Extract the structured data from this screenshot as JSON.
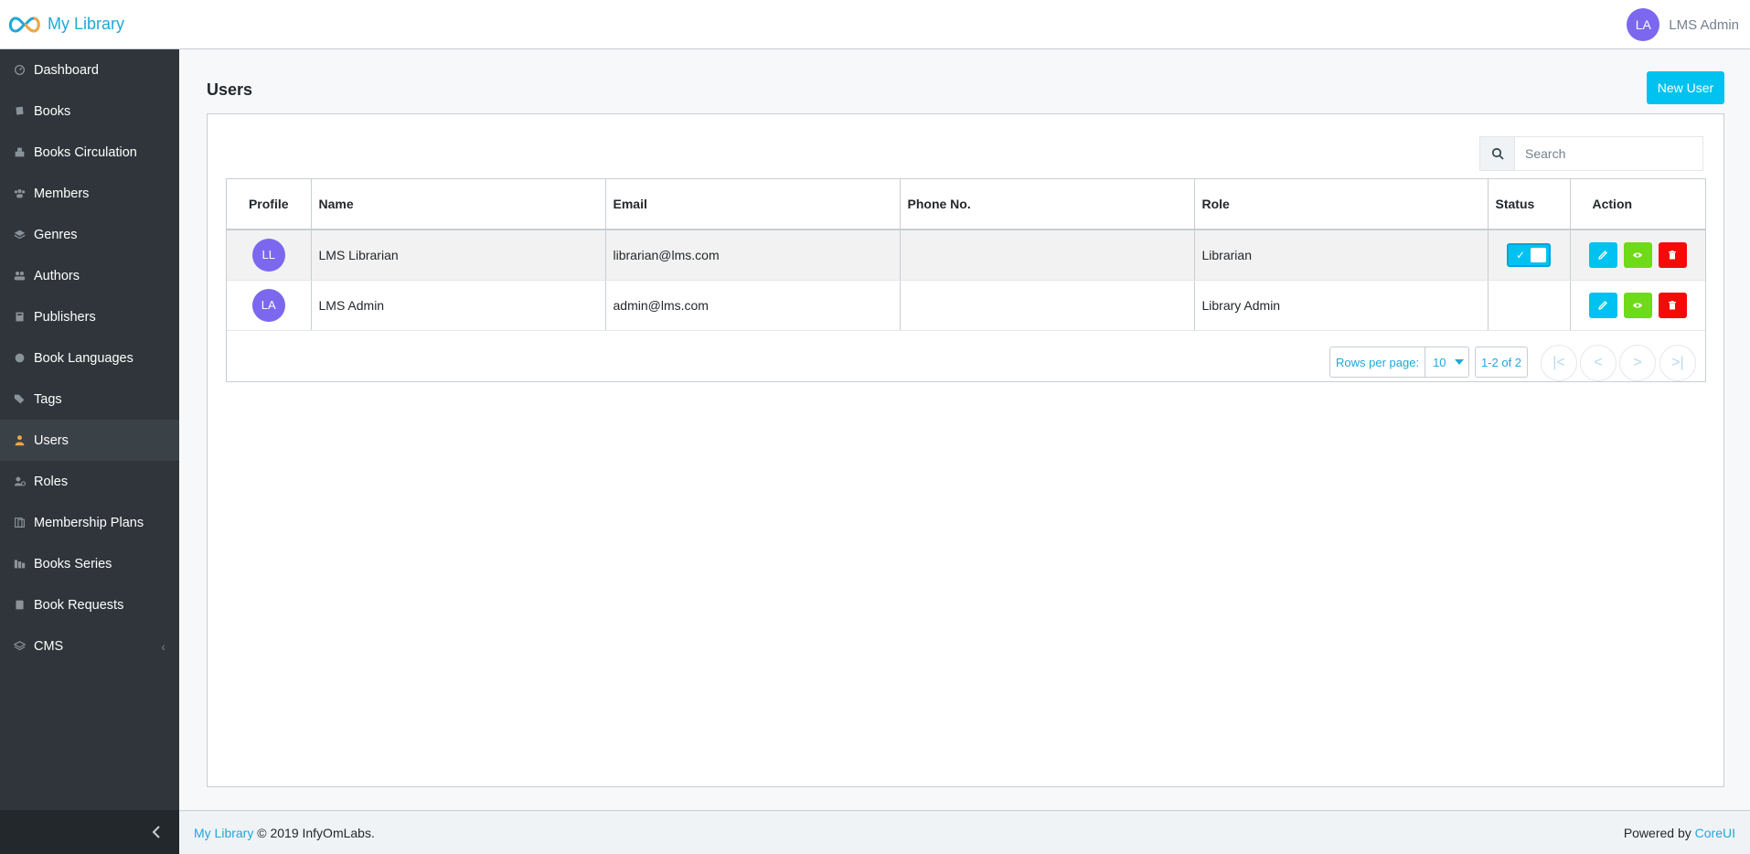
{
  "app": {
    "brand": "My Library"
  },
  "header": {
    "user_initials": "LA",
    "user_name": "LMS Admin"
  },
  "sidebar": {
    "items": [
      {
        "label": "Dashboard",
        "icon": "speedometer-icon"
      },
      {
        "label": "Books",
        "icon": "book-icon"
      },
      {
        "label": "Books Circulation",
        "icon": "circulation-icon"
      },
      {
        "label": "Members",
        "icon": "members-icon"
      },
      {
        "label": "Genres",
        "icon": "layers-icon"
      },
      {
        "label": "Authors",
        "icon": "authors-icon"
      },
      {
        "label": "Publishers",
        "icon": "publisher-icon"
      },
      {
        "label": "Book Languages",
        "icon": "globe-icon"
      },
      {
        "label": "Tags",
        "icon": "tags-icon"
      },
      {
        "label": "Users",
        "icon": "user-icon"
      },
      {
        "label": "Roles",
        "icon": "roles-icon"
      },
      {
        "label": "Membership Plans",
        "icon": "plans-icon"
      },
      {
        "label": "Books Series",
        "icon": "series-icon"
      },
      {
        "label": "Book Requests",
        "icon": "requests-icon"
      },
      {
        "label": "CMS",
        "icon": "cms-icon"
      }
    ],
    "active": "Users"
  },
  "main": {
    "title": "Users",
    "new_button": "New User",
    "search_placeholder": "Search",
    "table": {
      "columns": [
        "Profile",
        "Name",
        "Email",
        "Phone No.",
        "Role",
        "Status",
        "Action"
      ],
      "rows": [
        {
          "initials": "LL",
          "name": "LMS Librarian",
          "email": "librarian@lms.com",
          "phone": "",
          "role": "Librarian",
          "status_toggle": true,
          "status_on": true
        },
        {
          "initials": "LA",
          "name": "LMS Admin",
          "email": "admin@lms.com",
          "phone": "",
          "role": "Library Admin",
          "status_toggle": false,
          "status_on": false
        }
      ]
    },
    "pagination": {
      "rows_per_page_label": "Rows per page:",
      "rows_per_page": "10",
      "range": "1-2 of 2",
      "first": "|<",
      "prev": "<",
      "next": ">",
      "last": ">|"
    }
  },
  "footer": {
    "brand_link": "My Library",
    "copyright": "© 2019 InfyOmLabs.",
    "powered_by": "Powered by",
    "powered_link": "CoreUI"
  },
  "colors": {
    "accent": "#00c2f0",
    "view": "#6fda17",
    "delete": "#f50a0a",
    "avatar": "#7b68ee",
    "sidebar_bg": "#2f353a"
  }
}
